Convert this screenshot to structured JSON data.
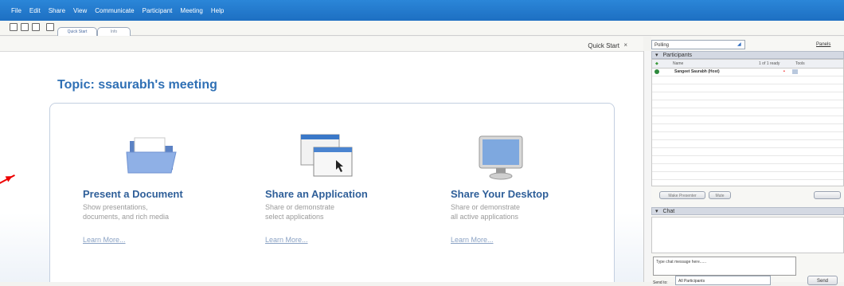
{
  "menu": [
    "File",
    "Edit",
    "Share",
    "View",
    "Communicate",
    "Participant",
    "Meeting",
    "Help"
  ],
  "tabs": [
    "Quick Start",
    "Info"
  ],
  "strip": {
    "label": "Quick Start",
    "close": "×"
  },
  "topic": "Topic: ssaurabh's meeting",
  "options": [
    {
      "title": "Present a Document",
      "line1": "Show presentations,",
      "line2": "documents, and rich media",
      "learn": "Learn More..."
    },
    {
      "title": "Share an Application",
      "line1": "Share or demonstrate",
      "line2": "select applications",
      "learn": "Learn More..."
    },
    {
      "title": "Share Your Desktop",
      "line1": "Share or demonstrate",
      "line2": "all active applications",
      "learn": "Learn More..."
    }
  ],
  "right": {
    "polling": "Polling",
    "panels": "Panels",
    "participants_label": "Participants",
    "col_name": "Name",
    "col_ready": "1 of 1 ready",
    "col_tools": "Tools",
    "participant": "Sangeet Saurabh (Host)",
    "btn_make_presenter": "Make Presenter",
    "btn_mute": "Mute",
    "chat_label": "Chat",
    "chat_placeholder": "Type chat message here......",
    "send": "Send",
    "send_to": "Send to:",
    "send_to_value": "All Participants"
  }
}
